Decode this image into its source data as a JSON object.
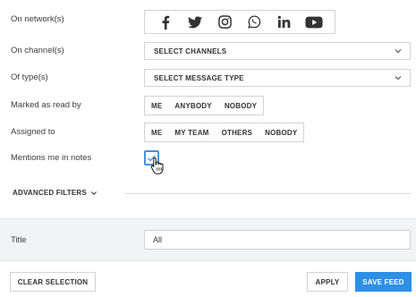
{
  "rows": {
    "network_label": "On network(s)",
    "channel_label": "On channel(s)",
    "type_label": "Of type(s)",
    "read_label": "Marked as read by",
    "assigned_label": "Assigned to",
    "mentions_label": "Mentions me in notes"
  },
  "networks": [
    {
      "name": "facebook",
      "icon": "facebook-icon"
    },
    {
      "name": "twitter",
      "icon": "twitter-icon"
    },
    {
      "name": "instagram",
      "icon": "instagram-icon"
    },
    {
      "name": "whatsapp",
      "icon": "whatsapp-icon"
    },
    {
      "name": "linkedin",
      "icon": "linkedin-icon"
    },
    {
      "name": "youtube",
      "icon": "youtube-icon"
    }
  ],
  "channel_select": {
    "value": "SELECT CHANNELS"
  },
  "type_select": {
    "value": "SELECT MESSAGE TYPE"
  },
  "read_options": [
    "ME",
    "ANYBODY",
    "NOBODY"
  ],
  "assigned_options": [
    "ME",
    "MY TEAM",
    "OTHERS",
    "NOBODY"
  ],
  "mentions_checked": true,
  "advanced_filters_label": "ADVANCED FILTERS",
  "title_section": {
    "label": "Title",
    "value": "All"
  },
  "footer": {
    "clear_label": "CLEAR SELECTION",
    "apply_label": "APPLY",
    "save_label": "SAVE FEED"
  },
  "colors": {
    "accent": "#2d8fe6",
    "border": "#cfd3d7",
    "band": "#f2f3f4"
  }
}
